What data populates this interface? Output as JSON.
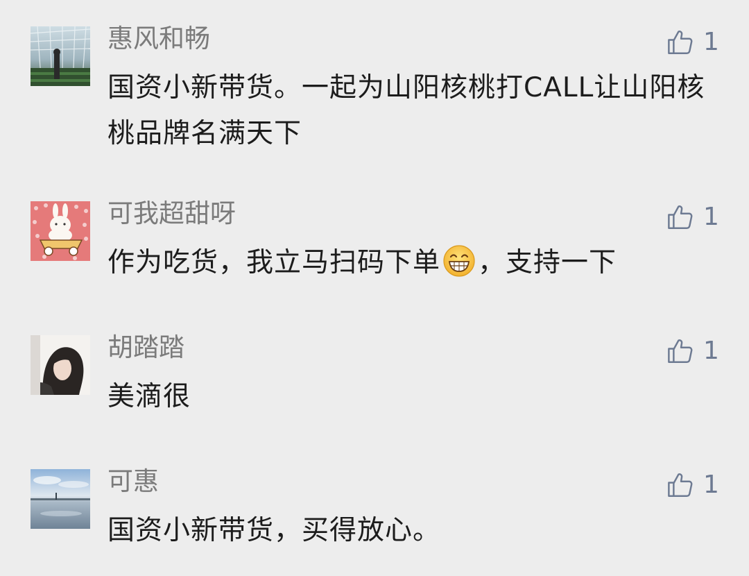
{
  "comments": [
    {
      "username": "惠风和畅",
      "likes": "1",
      "avatar_icon": "greenhouse-photo-avatar",
      "text": "国资小新带货。一起为山阳核桃打CALL让山阳核桃品牌名满天下"
    },
    {
      "username": "可我超甜呀",
      "likes": "1",
      "avatar_icon": "bunny-cart-avatar",
      "text_before_emoji": "作为吃货，我立马扫码下单",
      "emoji_icon": "grinning-face-emoji",
      "text_after_emoji": "，支持一下"
    },
    {
      "username": "胡踏踏",
      "likes": "1",
      "avatar_icon": "girl-portrait-avatar",
      "text": "美滴很"
    },
    {
      "username": "可惠",
      "likes": "1",
      "avatar_icon": "seaside-photo-avatar",
      "text": "国资小新带货，买得放心。"
    }
  ],
  "like_icon": "thumbs-up-outline-icon",
  "colors": {
    "background": "#ededed",
    "username": "#7b7b7b",
    "comment_text": "#1c1c1c",
    "like_icon": "#6d7a92"
  }
}
